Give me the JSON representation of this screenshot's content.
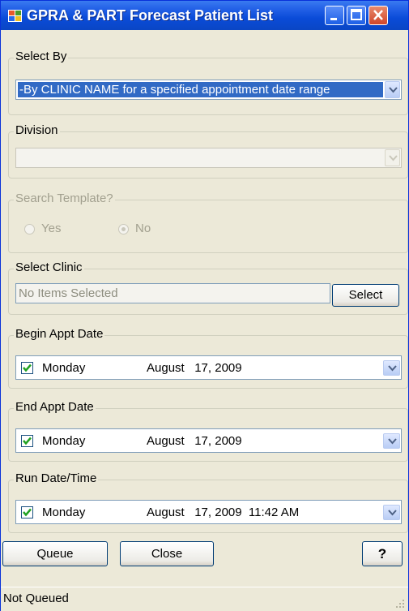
{
  "window": {
    "title": "GPRA & PART Forecast Patient List",
    "icon": "app-icon"
  },
  "select_by": {
    "legend": "Select By",
    "value": "-By CLINIC NAME for a specified appointment date range"
  },
  "division": {
    "legend": "Division",
    "value": ""
  },
  "search_template": {
    "legend": "Search Template?",
    "options": [
      {
        "label": "Yes",
        "checked": false
      },
      {
        "label": "No",
        "checked": true
      }
    ]
  },
  "select_clinic": {
    "legend": "Select Clinic",
    "value": "No Items Selected",
    "button": "Select"
  },
  "begin_appt": {
    "legend": "Begin Appt Date",
    "checked": true,
    "day": "Monday",
    "date": "August   17, 2009"
  },
  "end_appt": {
    "legend": "End Appt Date",
    "checked": true,
    "day": "Monday",
    "date": "August   17, 2009"
  },
  "run_date": {
    "legend": "Run Date/Time",
    "checked": true,
    "day": "Monday",
    "date": "August   17, 2009  11:42 AM"
  },
  "actions": {
    "queue": "Queue",
    "close": "Close",
    "help": "?"
  },
  "status": {
    "text": "Not Queued"
  },
  "colors": {
    "title_bar": "#0a4bd8",
    "selection": "#316ac5",
    "check_green": "#21a121",
    "window_bg": "#ece9d8"
  }
}
